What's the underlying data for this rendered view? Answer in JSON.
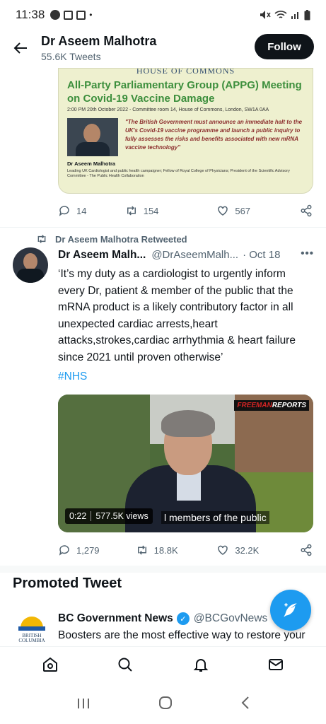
{
  "status_bar": {
    "time": "11:38"
  },
  "header": {
    "back_icon": "arrow-left-icon",
    "name": "Dr Aseem Malhotra",
    "tweets_count": "55.6K Tweets",
    "follow_label": "Follow"
  },
  "card": {
    "heading": "HOUSE OF COMMONS",
    "title": "All-Party Parliamentary Group (APPG) Meeting on Covid-19 Vaccine Damage",
    "time": "2:00 PM 20th October 2022 - Committee room 14, House of Commons, London, SW1A 0AA",
    "quote": "\"The British Government must announce an immediate halt to the UK's Covid-19 vaccine programme and launch a public inquiry to fully assesses the risks and benefits associated with new mRNA vaccine technology\"",
    "doctor": "Dr Aseem Malhotra",
    "doctor_desc": "Leading UK Cardiologist and public health campaigner; Fellow of Royal College of Physicians; President of the Scientific Advisory Committee - The Public Health Collaboration"
  },
  "first_actions": {
    "replies": "14",
    "retweets": "154",
    "likes": "567"
  },
  "retweet_line": "Dr Aseem Malhotra Retweeted",
  "tweet": {
    "name": "Dr Aseem Malh...",
    "handle": "@DrAseemMalh...",
    "date": "· Oct 18",
    "more": "•••",
    "text": "‘It’s my duty as a cardiologist to urgently inform every Dr, patient & member of the public that the mRNA product is a likely contributory factor in all unexpected cardiac arrests,heart attacks,strokes,cardiac arrhythmia & heart failure since 2021 until proven otherwise’",
    "hashtag": "#NHS",
    "video": {
      "logo_a": "FREEMAN",
      "logo_b": "REPORTS",
      "duration": "0:22",
      "views": "577.5K views",
      "caption": "l members of the public"
    },
    "actions": {
      "replies": "1,279",
      "retweets": "18.8K",
      "likes": "32.2K"
    }
  },
  "promoted": {
    "heading": "Promoted Tweet",
    "logo_text": "BRITISH COLUMBIA",
    "name": "BC Government News",
    "handle": "@BCGovNews",
    "text": "Boosters are the most effective way to restore your"
  },
  "bottom_nav": [
    "home-icon",
    "search-icon",
    "notifications-icon",
    "messages-icon"
  ],
  "system_nav": [
    "recents",
    "home",
    "back"
  ]
}
